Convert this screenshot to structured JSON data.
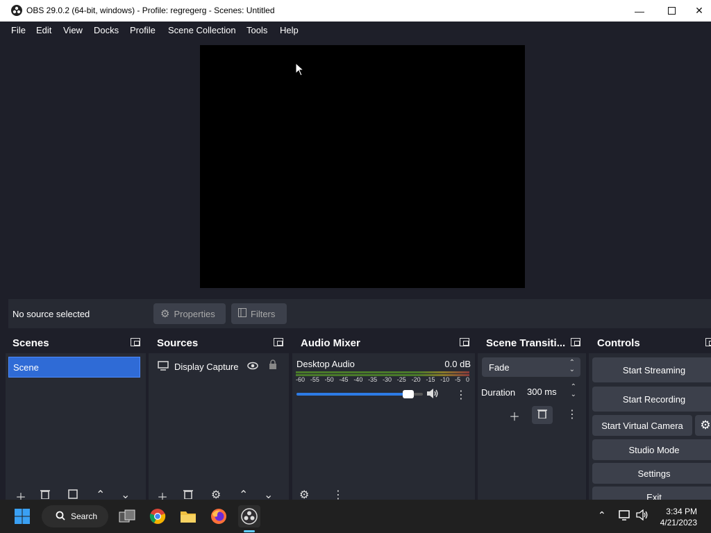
{
  "window": {
    "title": "OBS 29.0.2 (64-bit, windows) - Profile: regregerg - Scenes: Untitled",
    "minimize_icon": "minimize-icon",
    "maximize_icon": "maximize-icon",
    "close_icon": "close-icon"
  },
  "menu": [
    "File",
    "Edit",
    "View",
    "Docks",
    "Profile",
    "Scene Collection",
    "Tools",
    "Help"
  ],
  "context_bar": {
    "status": "No source selected",
    "properties_label": "Properties",
    "filters_label": "Filters"
  },
  "scenes": {
    "title": "Scenes",
    "items": [
      "Scene"
    ]
  },
  "sources": {
    "title": "Sources",
    "items": [
      {
        "name": "Display Capture",
        "icon": "monitor-icon"
      }
    ]
  },
  "audio_mixer": {
    "title": "Audio Mixer",
    "channel": "Desktop Audio",
    "level": "0.0 dB",
    "ticks": [
      "-60",
      "-55",
      "-50",
      "-45",
      "-40",
      "-35",
      "-30",
      "-25",
      "-20",
      "-15",
      "-10",
      "-5",
      "0"
    ],
    "volume_fraction": 0.92
  },
  "transitions": {
    "title": "Scene Transiti...",
    "selected": "Fade",
    "duration_label": "Duration",
    "duration_value": "300 ms"
  },
  "controls": {
    "title": "Controls",
    "start_streaming": "Start Streaming",
    "start_recording": "Start Recording",
    "start_virtual_camera": "Start Virtual Camera",
    "studio_mode": "Studio Mode",
    "settings": "Settings",
    "exit": "Exit"
  },
  "taskbar": {
    "search_label": "Search",
    "time": "3:34 PM",
    "date": "4/21/2023"
  },
  "colors": {
    "background": "#1e1f29",
    "dock": "#272a33",
    "selected": "#2f6bd6",
    "volume": "#2d7be5"
  }
}
